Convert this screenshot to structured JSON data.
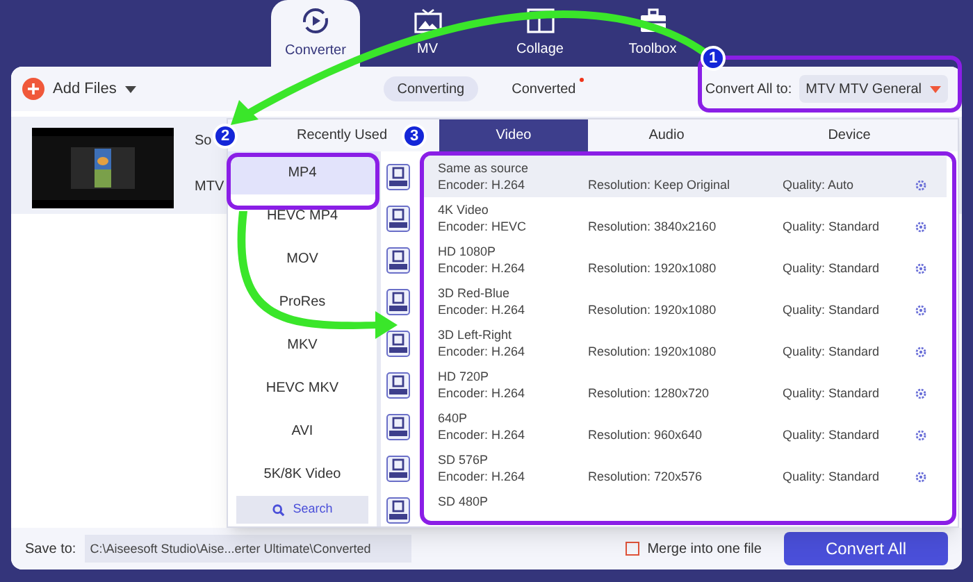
{
  "tabs": [
    {
      "label": "Converter",
      "kind": "converter",
      "selected": true
    },
    {
      "label": "MV",
      "kind": "mv",
      "selected": false
    },
    {
      "label": "Collage",
      "kind": "collage",
      "selected": false
    },
    {
      "label": "Toolbox",
      "kind": "toolbox",
      "selected": false
    }
  ],
  "toolbar": {
    "add_files": "Add Files",
    "views": [
      {
        "label": "Converting",
        "selected": true,
        "dot": false
      },
      {
        "label": "Converted",
        "selected": false,
        "dot": true
      }
    ],
    "convert_all_label": "Convert All to:",
    "convert_all_value": "MTV MTV General"
  },
  "file": {
    "source_label": "So",
    "format_label": "MTV"
  },
  "format_panel": {
    "tabs": [
      {
        "label": "Recently Used",
        "selected": false
      },
      {
        "label": "Video",
        "selected": true
      },
      {
        "label": "Audio",
        "selected": false
      },
      {
        "label": "Device",
        "selected": false
      }
    ],
    "formats": [
      {
        "label": "MP4",
        "selected": true
      },
      {
        "label": "HEVC MP4",
        "selected": false
      },
      {
        "label": "MOV",
        "selected": false
      },
      {
        "label": "ProRes",
        "selected": false
      },
      {
        "label": "MKV",
        "selected": false
      },
      {
        "label": "HEVC MKV",
        "selected": false
      },
      {
        "label": "AVI",
        "selected": false
      },
      {
        "label": "5K/8K Video",
        "selected": false
      }
    ],
    "search": "Search",
    "presets": [
      {
        "name": "Same as source",
        "encoder": "Encoder: H.264",
        "resolution": "Resolution: Keep Original",
        "quality": "Quality: Auto",
        "selected": true
      },
      {
        "name": "4K Video",
        "encoder": "Encoder: HEVC",
        "resolution": "Resolution: 3840x2160",
        "quality": "Quality: Standard",
        "selected": false
      },
      {
        "name": "HD 1080P",
        "encoder": "Encoder: H.264",
        "resolution": "Resolution: 1920x1080",
        "quality": "Quality: Standard",
        "selected": false
      },
      {
        "name": "3D Red-Blue",
        "encoder": "Encoder: H.264",
        "resolution": "Resolution: 1920x1080",
        "quality": "Quality: Standard",
        "selected": false
      },
      {
        "name": "3D Left-Right",
        "encoder": "Encoder: H.264",
        "resolution": "Resolution: 1920x1080",
        "quality": "Quality: Standard",
        "selected": false
      },
      {
        "name": "HD 720P",
        "encoder": "Encoder: H.264",
        "resolution": "Resolution: 1280x720",
        "quality": "Quality: Standard",
        "selected": false
      },
      {
        "name": "640P",
        "encoder": "Encoder: H.264",
        "resolution": "Resolution: 960x640",
        "quality": "Quality: Standard",
        "selected": false
      },
      {
        "name": "SD 576P",
        "encoder": "Encoder: H.264",
        "resolution": "Resolution: 720x576",
        "quality": "Quality: Standard",
        "selected": false
      },
      {
        "name": "SD 480P",
        "selected": false
      }
    ]
  },
  "bottom": {
    "save_to_label": "Save to:",
    "path": "C:\\Aiseesoft Studio\\Aise...erter Ultimate\\Converted",
    "merge_label": "Merge into one file",
    "merge_checked": false,
    "convert_button": "Convert All"
  },
  "annotations": [
    {
      "number": "1"
    },
    {
      "number": "2"
    },
    {
      "number": "3"
    }
  ]
}
